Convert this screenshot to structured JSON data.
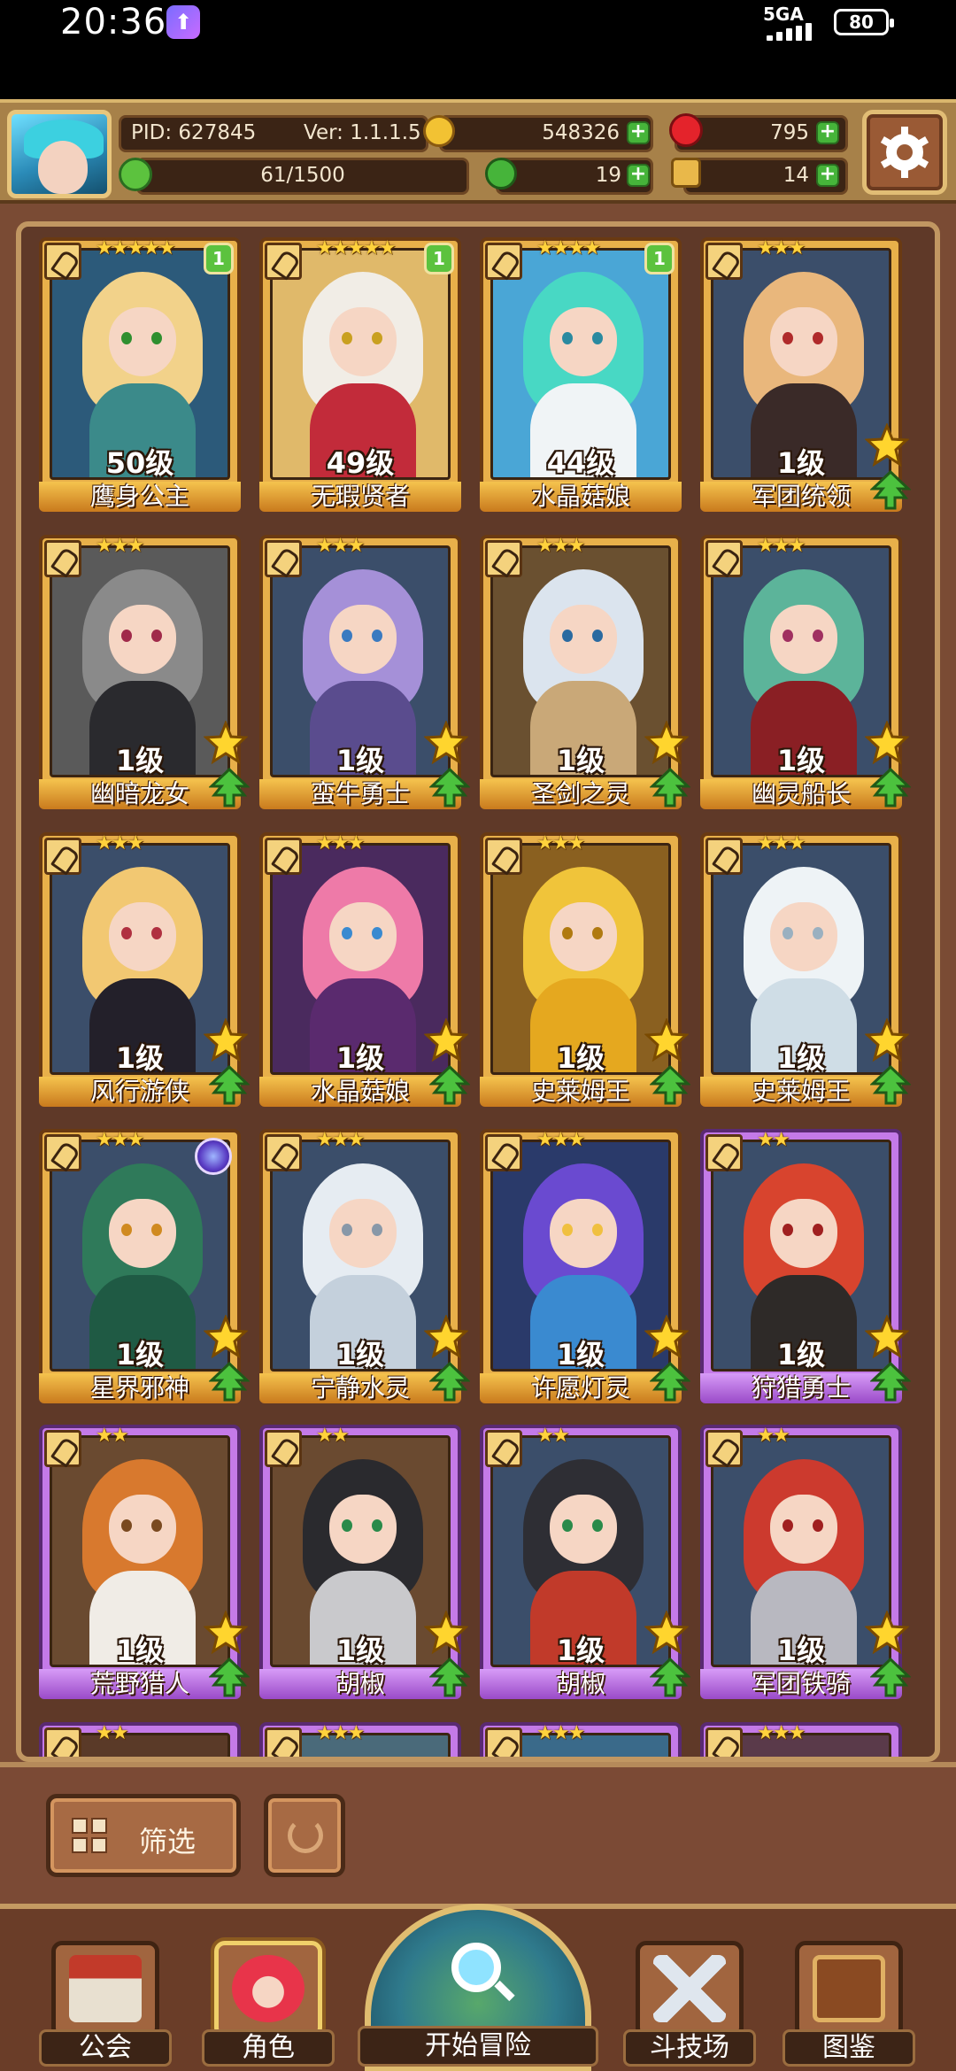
{
  "status_bar": {
    "time": "20:36",
    "network": "5GA",
    "battery": "80"
  },
  "top_bar": {
    "pid": "PID: 627845",
    "version": "Ver: 1.1.1.5",
    "gold": "548326",
    "gems": "795",
    "energy": "61/1500",
    "clover": "19",
    "keys": "14"
  },
  "roster": [
    {
      "name": "鹰身公主",
      "level": "50级",
      "stars": "★★★★★",
      "frame": "gold",
      "count": "1",
      "hair": "#f2d28a",
      "body": "#3b8a8a",
      "eye": "#2f8f2f",
      "bg": "#2c5a7a"
    },
    {
      "name": "无瑕贤者",
      "level": "49级",
      "stars": "★★★★★",
      "frame": "gold",
      "count": "1",
      "hair": "#f1ede6",
      "body": "#c22b3a",
      "eye": "#c9a020",
      "bg": "#e0b96a"
    },
    {
      "name": "水晶菇娘",
      "level": "44级",
      "stars": "★★★★",
      "frame": "gold",
      "count": "1",
      "hair": "#48d8c4",
      "body": "#f0f4f6",
      "eye": "#2a8aa0",
      "bg": "#4aa6d6"
    },
    {
      "name": "军团统领",
      "level": "1级",
      "stars": "★★★",
      "frame": "gold",
      "count": "",
      "hair": "#e9b77c",
      "body": "#3a2a28",
      "eye": "#b02a2a",
      "bg": "#3b4e6a"
    },
    {
      "name": "幽暗龙女",
      "level": "1级",
      "stars": "★★★",
      "frame": "gold",
      "count": "",
      "hair": "#8a8a8a",
      "body": "#2a2a2e",
      "eye": "#a02a4a",
      "bg": "#5a5a5a"
    },
    {
      "name": "蛮牛勇士",
      "level": "1级",
      "stars": "★★★",
      "frame": "gold",
      "count": "",
      "hair": "#a590d8",
      "body": "#5a4c8e",
      "eye": "#3a7ac0",
      "bg": "#3b4e6a"
    },
    {
      "name": "圣剑之灵",
      "level": "1级",
      "stars": "★★★",
      "frame": "gold",
      "count": "",
      "hair": "#dbe4ee",
      "body": "#c9a878",
      "eye": "#2a6aa0",
      "bg": "#6a5030"
    },
    {
      "name": "幽灵船长",
      "level": "1级",
      "stars": "★★★",
      "frame": "gold",
      "count": "",
      "hair": "#5cb49a",
      "body": "#8a1f24",
      "eye": "#a03060",
      "bg": "#3b4e6a"
    },
    {
      "name": "风行游侠",
      "level": "1级",
      "stars": "★★★",
      "frame": "gold",
      "count": "",
      "hair": "#f2c872",
      "body": "#23202a",
      "eye": "#b03040",
      "bg": "#3b4e6a"
    },
    {
      "name": "水晶菇娘",
      "level": "1级",
      "stars": "★★★",
      "frame": "gold",
      "count": "",
      "hair": "#ee7aa8",
      "body": "#5a2a6e",
      "eye": "#3a8ad0",
      "bg": "#4a2a5e"
    },
    {
      "name": "史莱姆王",
      "level": "1级",
      "stars": "★★★",
      "frame": "gold",
      "count": "",
      "hair": "#f0c43a",
      "body": "#e5a81f",
      "eye": "#b07a10",
      "bg": "#8a6020"
    },
    {
      "name": "史莱姆王",
      "level": "1级",
      "stars": "★★★",
      "frame": "gold",
      "count": "",
      "hair": "#eef3f6",
      "body": "#cfdde6",
      "eye": "#9ab0c0",
      "bg": "#3b4e6a"
    },
    {
      "name": "星界邪神",
      "level": "1级",
      "stars": "★★★",
      "frame": "gold",
      "count": "",
      "hair": "#2f7a5a",
      "body": "#1f5a44",
      "eye": "#d08a20",
      "bg": "#3b4e6a",
      "special": true
    },
    {
      "name": "宁静水灵",
      "level": "1级",
      "stars": "★★★",
      "frame": "gold",
      "count": "",
      "hair": "#e6ecf2",
      "body": "#c4d0dc",
      "eye": "#8898a8",
      "bg": "#3b4e6a"
    },
    {
      "name": "许愿灯灵",
      "level": "1级",
      "stars": "★★★",
      "frame": "gold",
      "count": "",
      "hair": "#6a4ad0",
      "body": "#3a8ad0",
      "eye": "#f0c040",
      "bg": "#2a3a6a"
    },
    {
      "name": "狩猎勇士",
      "level": "1级",
      "stars": "★★",
      "frame": "purple",
      "count": "",
      "hair": "#d8442e",
      "body": "#2e2a28",
      "eye": "#a02020",
      "bg": "#3b4e6a"
    },
    {
      "name": "荒野猎人",
      "level": "1级",
      "stars": "★★",
      "frame": "purple",
      "count": "",
      "hair": "#d8792e",
      "body": "#f0ece6",
      "eye": "#7a4a20",
      "bg": "#6a4a30"
    },
    {
      "name": "胡椒",
      "level": "1级",
      "stars": "★★",
      "frame": "purple",
      "count": "",
      "hair": "#2a2a2e",
      "body": "#c9c9cc",
      "eye": "#2a8a4a",
      "bg": "#6a4a30"
    },
    {
      "name": "胡椒",
      "level": "1级",
      "stars": "★★",
      "frame": "purple",
      "count": "",
      "hair": "#2e2e34",
      "body": "#c13a2a",
      "eye": "#2a8a4a",
      "bg": "#3b4e6a"
    },
    {
      "name": "军团铁骑",
      "level": "1级",
      "stars": "★★",
      "frame": "purple",
      "count": "",
      "hair": "#cc3a2e",
      "body": "#b8b8c0",
      "eye": "#a02020",
      "bg": "#3b4e6a"
    },
    {
      "name": "",
      "level": "",
      "stars": "★★",
      "frame": "purple",
      "count": "",
      "hair": "#7a4a20",
      "body": "#7a4a20",
      "eye": "#7a4a20",
      "bg": "#5a3a28",
      "partial": true
    },
    {
      "name": "",
      "level": "",
      "stars": "★★★",
      "frame": "purple",
      "count": "",
      "hair": "#cfe0e6",
      "body": "#cfe0e6",
      "eye": "#cfe0e6",
      "bg": "#4a6a7a",
      "partial": true
    },
    {
      "name": "",
      "level": "",
      "stars": "★★★",
      "frame": "purple",
      "count": "",
      "hair": "#58b8d8",
      "body": "#58b8d8",
      "eye": "#58b8d8",
      "bg": "#3a6a8a",
      "partial": true
    },
    {
      "name": "",
      "level": "",
      "stars": "★★★",
      "frame": "purple",
      "count": "",
      "hair": "#8a2a4a",
      "body": "#8a2a4a",
      "eye": "#8a2a4a",
      "bg": "#5a3a4a",
      "partial": true
    }
  ],
  "filter": {
    "label": "筛选"
  },
  "nav": {
    "guild": "公会",
    "character": "角色",
    "adventure": "开始冒险",
    "arena": "斗技场",
    "codex": "图鉴"
  }
}
